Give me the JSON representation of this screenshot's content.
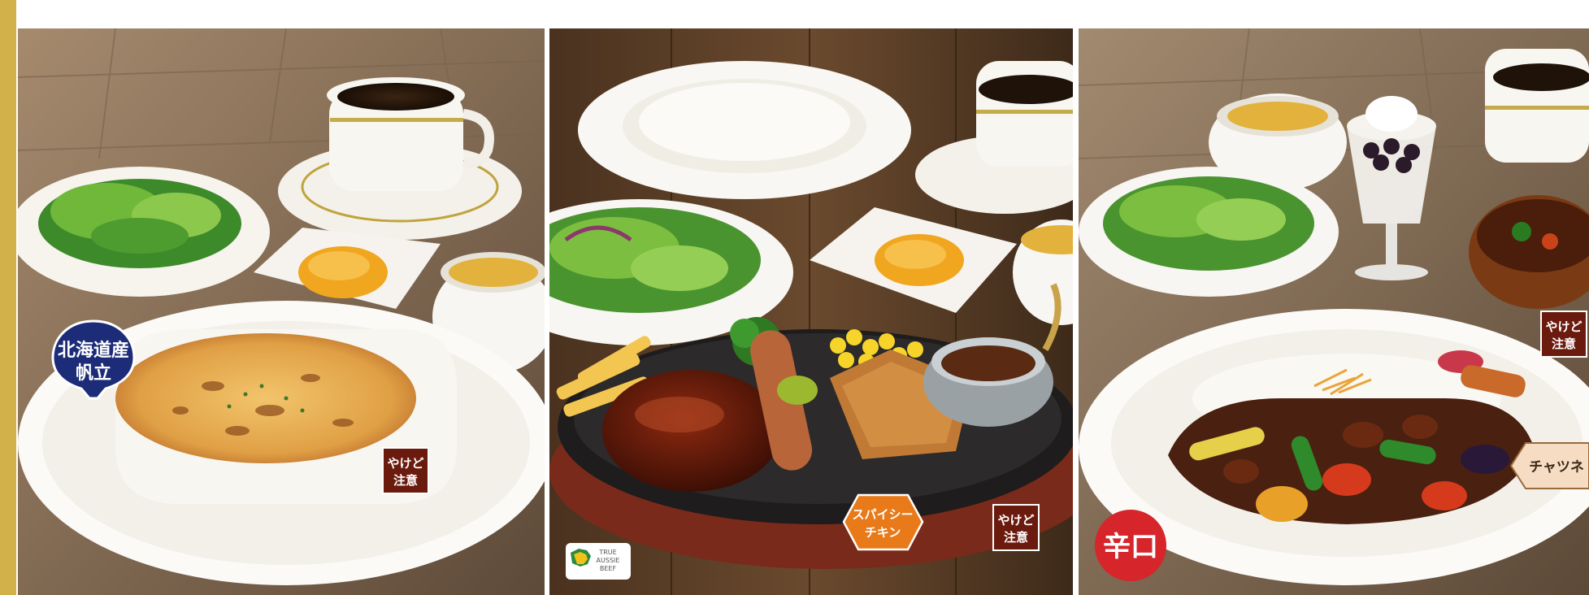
{
  "panels": [
    {
      "name": "gratin-set",
      "badge": {
        "line1": "北海道産",
        "line2": "帆立"
      },
      "caution": {
        "line1": "やけど",
        "line2": "注意"
      }
    },
    {
      "name": "hamburg-set",
      "caution": {
        "line1": "やけど",
        "line2": "注意"
      },
      "spicy_tag": {
        "line1": "スパイシー",
        "line2": "チキン"
      },
      "logo": {
        "line1": "TRUE",
        "line2": "AUSSIE",
        "line3": "BEEF"
      }
    },
    {
      "name": "curry-set",
      "caution": {
        "line1": "やけど",
        "line2": "注意"
      },
      "chutney_tag": "チャツネ",
      "spicy_circle": "辛口"
    }
  ],
  "colors": {
    "gold": "#d2b04a",
    "navy_badge": "#1c2c78",
    "caution_bg": "#6b1b0e",
    "orange_tag": "#e87a1a",
    "red_circle": "#d6252b",
    "chutney_bg": "#f6dcc2"
  }
}
